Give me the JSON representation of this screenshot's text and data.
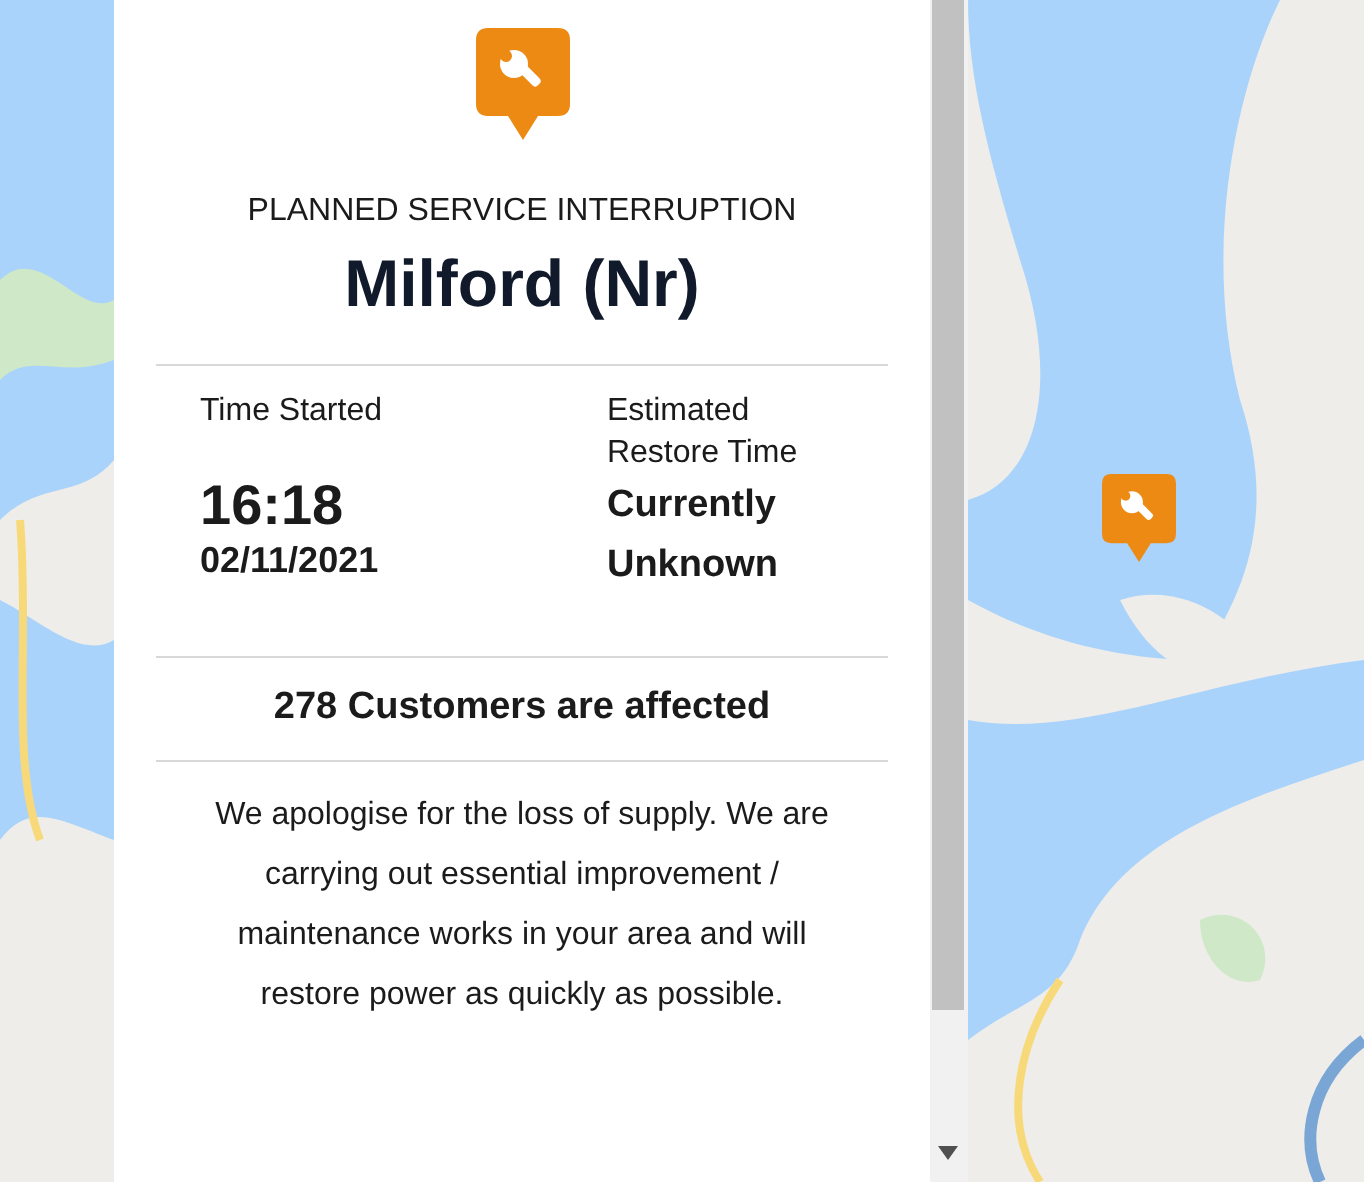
{
  "panel": {
    "category": "PLANNED SERVICE INTERRUPTION",
    "title": "Milford (Nr)",
    "started": {
      "label": "Time Started",
      "time": "16:18",
      "date": "02/11/2021"
    },
    "restore": {
      "label": "Estimated Restore Time",
      "value": "Currently Unknown"
    },
    "affected": "278 Customers are affected",
    "message": "We apologise for the loss of supply. We are carrying out essential improvement / maintenance works in your area and will restore power as quickly as possible."
  }
}
